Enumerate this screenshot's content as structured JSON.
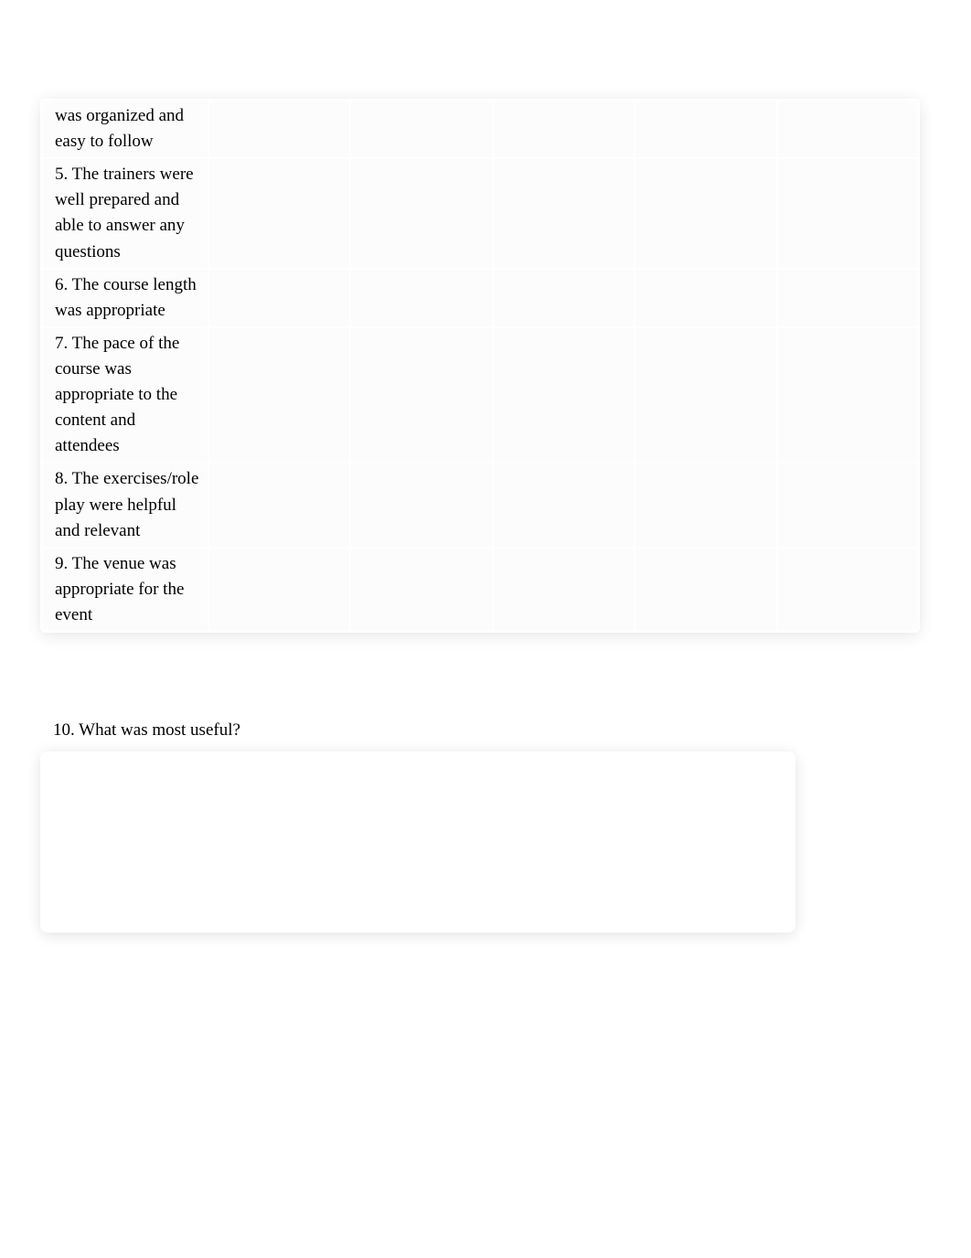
{
  "rating_grid": {
    "columns": 5,
    "rows": [
      {
        "label": "was organized and easy to follow"
      },
      {
        "label": "5. The trainers were well prepared and able to answer any questions"
      },
      {
        "label": "6. The course length was appropriate"
      },
      {
        "label": "7. The pace of the course was appropriate to the content and attendees"
      },
      {
        "label": "8. The exercises/role play were helpful and relevant"
      },
      {
        "label": "9. The venue was appropriate for the event"
      }
    ]
  },
  "open_question": {
    "label": "10. What was most useful?",
    "value": ""
  }
}
